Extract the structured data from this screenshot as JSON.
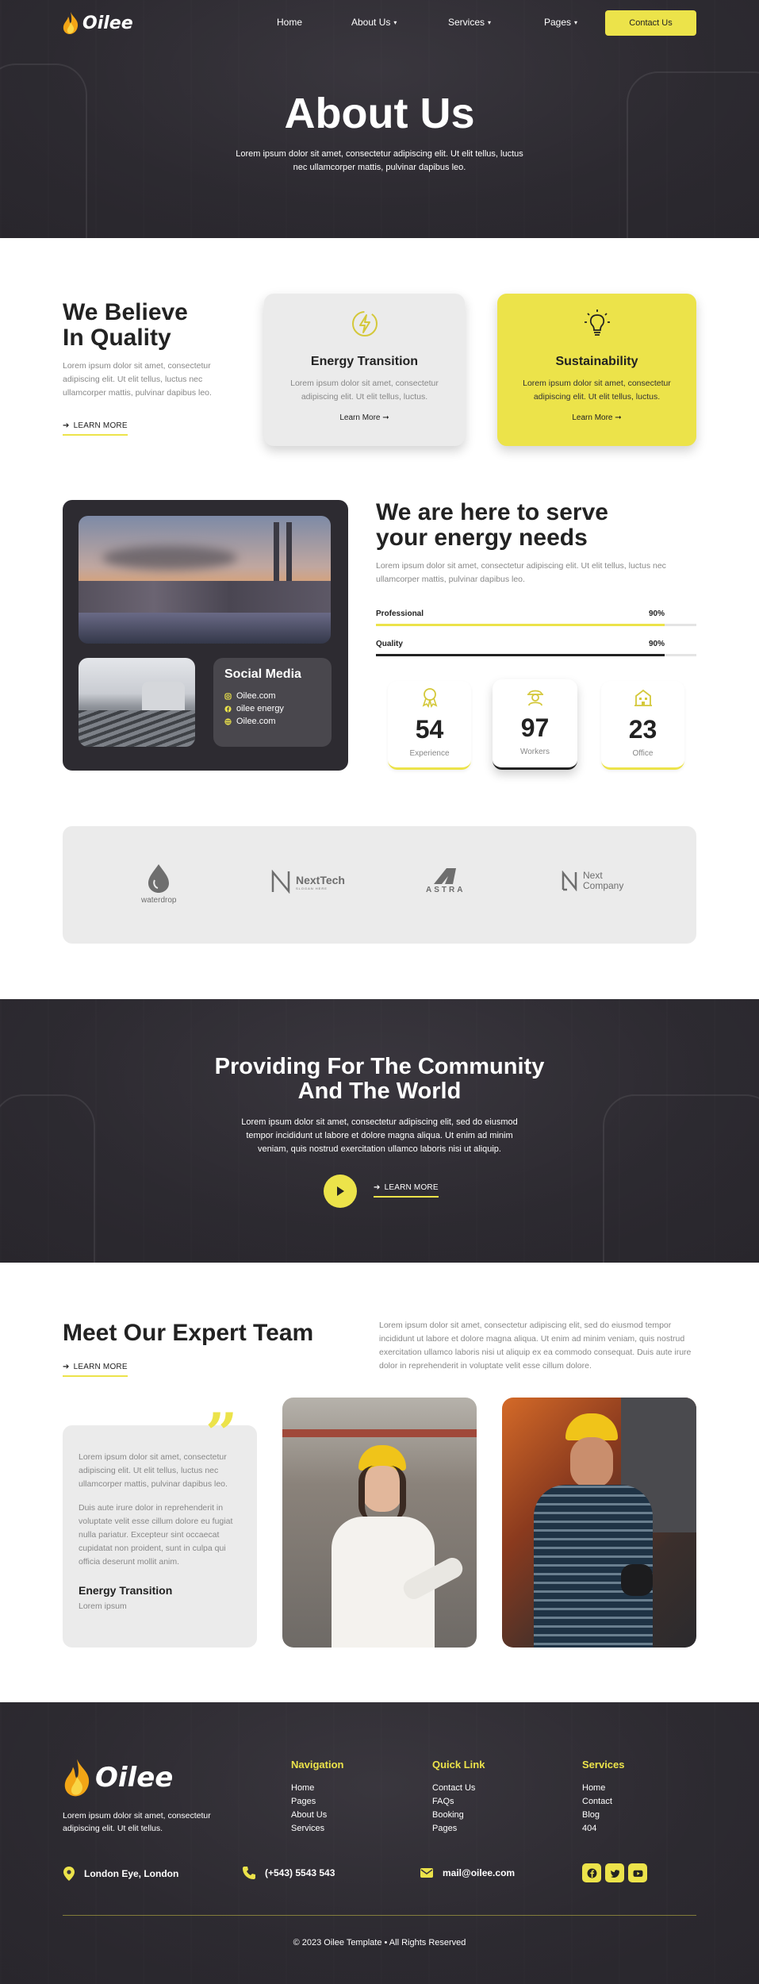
{
  "colors": {
    "accent": "#ece34a",
    "dark": "#2d2b31",
    "light_panel": "#ebebeb"
  },
  "header": {
    "logo": "Oilee",
    "nav": [
      {
        "label": "Home",
        "has_dropdown": false
      },
      {
        "label": "About Us",
        "has_dropdown": true
      },
      {
        "label": "Services",
        "has_dropdown": true
      },
      {
        "label": "Pages",
        "has_dropdown": true
      }
    ],
    "cta": "Contact Us"
  },
  "hero": {
    "title": "About Us",
    "text_line1": "Lorem ipsum dolor sit amet, consectetur adipiscing elit. Ut elit tellus, luctus",
    "text_line2": "nec ullamcorper mattis, pulvinar dapibus leo."
  },
  "quality": {
    "title_line1": "We Believe",
    "title_line2": "In Quality",
    "text": "Lorem ipsum dolor sit amet, consectetur adipiscing elit. Ut elit tellus, luctus nec ullamcorper mattis, pulvinar dapibus leo.",
    "learn_more": "LEARN MORE",
    "cards": [
      {
        "icon": "bolt-icon",
        "title": "Energy Transition",
        "text": "Lorem ipsum dolor sit amet, consectetur adipiscing elit. Ut elit tellus, luctus.",
        "more": "Learn More"
      },
      {
        "icon": "lightbulb-icon",
        "title": "Sustainability",
        "text": "Lorem ipsum dolor sit amet, consectetur adipiscing elit. Ut elit tellus, luctus.",
        "more": "Learn More"
      }
    ]
  },
  "serve": {
    "title_line1": "We are here to serve",
    "title_line2": "your energy needs",
    "text": "Lorem ipsum dolor sit amet, consectetur adipiscing elit. Ut elit tellus, luctus nec ullamcorper mattis, pulvinar dapibus leo.",
    "social": {
      "title": "Social Media",
      "items": [
        {
          "icon": "instagram-icon",
          "label": "Oilee.com"
        },
        {
          "icon": "facebook-icon",
          "label": "oilee energy"
        },
        {
          "icon": "globe-icon",
          "label": "Oilee.com"
        }
      ]
    },
    "progress": [
      {
        "label": "Professional",
        "value_text": "90%",
        "value": 0.9
      },
      {
        "label": "Quality",
        "value_text": "90%",
        "value": 0.9
      }
    ],
    "stats": [
      {
        "icon": "award-icon",
        "number": "54",
        "label": "Experience"
      },
      {
        "icon": "worker-icon",
        "number": "97",
        "label": "Workers"
      },
      {
        "icon": "building-icon",
        "number": "23",
        "label": "Office"
      }
    ]
  },
  "brands": [
    {
      "name": "waterdrop"
    },
    {
      "name": "NextTech",
      "sub": "SLOGAN HERE"
    },
    {
      "name": "ASTRA"
    },
    {
      "name": "Next",
      "name2": "Company"
    }
  ],
  "community": {
    "title_line1": "Providing For The Community",
    "title_line2": "And The World",
    "text_line1": "Lorem ipsum dolor sit amet, consectetur adipiscing elit, sed do eiusmod",
    "text_line2": "tempor incididunt ut labore et dolore magna aliqua. Ut enim ad minim",
    "text_line3": "veniam, quis nostrud exercitation ullamco laboris nisi ut aliquip.",
    "learn_more": "LEARN MORE"
  },
  "team": {
    "title": "Meet Our Expert Team",
    "learn_more": "LEARN MORE",
    "intro": "Lorem ipsum dolor sit amet, consectetur adipiscing elit, sed do eiusmod tempor incididunt ut labore et dolore magna aliqua. Ut enim ad minim veniam, quis nostrud exercitation ullamco laboris nisi ut aliquip ex ea commodo consequat. Duis aute irure dolor in reprehenderit in voluptate velit esse cillum dolore.",
    "quote_p1": "Lorem ipsum dolor sit amet, consectetur adipiscing elit. Ut elit tellus, luctus nec ullamcorper mattis, pulvinar dapibus leo.",
    "quote_p2": "Duis aute irure dolor in reprehenderit in voluptate velit esse cillum dolore eu fugiat nulla pariatur. Excepteur sint occaecat cupidatat non proident, sunt in culpa qui officia deserunt mollit anim.",
    "quote_title": "Energy Transition",
    "quote_sub": "Lorem ipsum"
  },
  "footer": {
    "logo": "Oilee",
    "text": "Lorem ipsum dolor sit amet, consectetur adipiscing elit. Ut elit tellus.",
    "columns": [
      {
        "title": "Navigation",
        "links": [
          "Home",
          "Pages",
          "About Us",
          "Services"
        ]
      },
      {
        "title": "Quick Link",
        "links": [
          "Contact Us",
          "FAQs",
          "Booking",
          "Pages"
        ]
      },
      {
        "title": "Services",
        "links": [
          "Home",
          "Contact",
          "Blog",
          "404"
        ]
      }
    ],
    "address": "London Eye, London",
    "phone": "(+543) 5543 543",
    "email": "mail@oilee.com",
    "social": [
      "facebook-icon",
      "twitter-icon",
      "youtube-icon"
    ],
    "copyright": "© 2023 Oilee Template • All Rights Reserved"
  }
}
